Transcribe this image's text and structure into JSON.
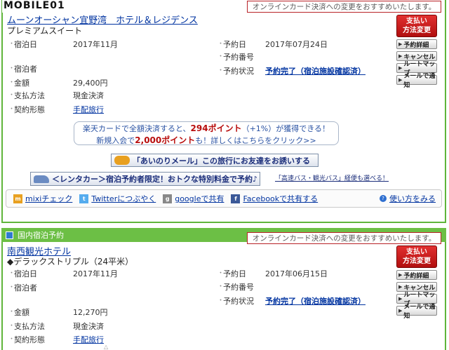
{
  "logo": "MOBILE01",
  "pay_banner": "オンラインカード決済への変更をおすすめいたします。",
  "buttons": {
    "pay_change": [
      "支払い",
      "方法変更"
    ],
    "detail": "予約詳細",
    "cancel": "キャンセル",
    "route": "ルートマップ",
    "mail": "メールで通知"
  },
  "booking1": {
    "hotel": "ムーンオーシャン宜野湾　ホテル＆レジデンス",
    "room": "プレミアムスイート",
    "stay_label": "宿泊日",
    "stay_value": "2017年11月",
    "guest_label": "宿泊者",
    "amount_label": "金額",
    "amount_value": "29,400円",
    "pay_label": "支払方法",
    "pay_value": "現金決済",
    "contract_label": "契約形態",
    "contract_value": "手配旅行",
    "resv_date_label": "予約日",
    "resv_date_value": "2017年07月24日",
    "resv_no_label": "予約番号",
    "status_label": "予約状況",
    "status_value": "予約完了（宿泊施設確認済）"
  },
  "promo": {
    "line1_a": "楽天カードで全額決済すると、",
    "line1_pt": "294ポイント",
    "line1_b": "（+1%）が獲得できる！",
    "line2_a": "新規入会で",
    "line2_pt": "2,000ポイント",
    "line2_b": "も！詳しくはこちらをクリック>>"
  },
  "aino": "「あいのりメール」この旅行にお友達をお誘いする",
  "rent": "＜レンタカー＞宿泊予約者限定！おトクな特別料金で予約♪",
  "bus": "「高速バス・観光バス」経便も選べる！",
  "share": {
    "mixi": "mixiチェック",
    "twitter": "Twitterにつぶやく",
    "google": "googleで共有",
    "facebook": "Facebookで共有する",
    "howto": "使い方をみる"
  },
  "section2_header": "国内宿泊予約",
  "booking2": {
    "hotel": "南西観光ホテル",
    "room": "◆デラックストリプル（24平米）",
    "stay_label": "宿泊日",
    "stay_value": "2017年11月",
    "guest_label": "宿泊者",
    "amount_label": "金額",
    "amount_value": "12,270円",
    "pay_label": "支払方法",
    "pay_value": "現金決済",
    "contract_label": "契約形態",
    "contract_value": "手配旅行",
    "resv_date_label": "予約日",
    "resv_date_value": "2017年06月15日",
    "resv_no_label": "予約番号",
    "status_label": "予約状況",
    "status_value": "予約完了（宿泊施設確認済）"
  }
}
